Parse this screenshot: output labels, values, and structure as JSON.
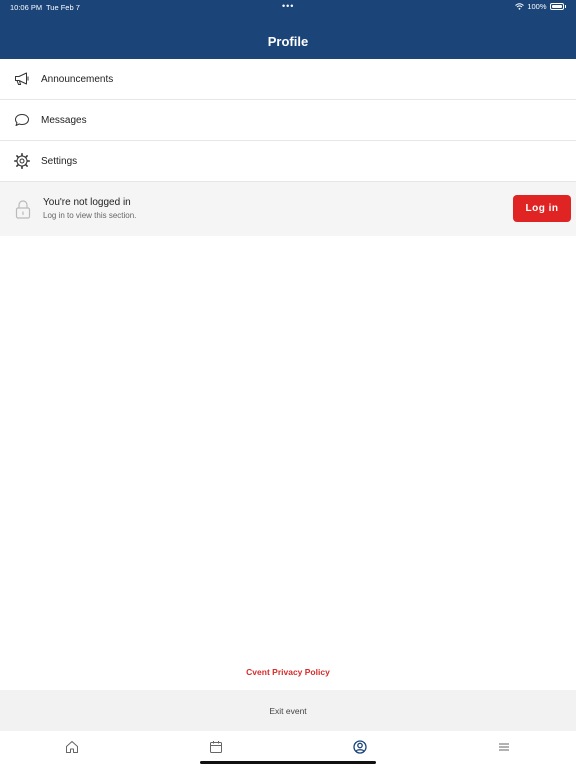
{
  "status_bar": {
    "time": "10:06 PM",
    "date": "Tue Feb 7",
    "dots": "•••",
    "battery_percent": "100%"
  },
  "header": {
    "title": "Profile"
  },
  "menu": {
    "items": [
      {
        "label": "Announcements",
        "icon": "megaphone-icon"
      },
      {
        "label": "Messages",
        "icon": "chat-bubble-icon"
      },
      {
        "label": "Settings",
        "icon": "gear-icon"
      }
    ]
  },
  "login": {
    "title": "You're not logged in",
    "subtitle": "Log in to view this section.",
    "button_label": "Log in",
    "icon": "lock-icon"
  },
  "footer": {
    "privacy_link": "Cvent Privacy Policy",
    "exit_label": "Exit event"
  },
  "tabbar": {
    "tabs": [
      {
        "icon": "home-icon",
        "active": false
      },
      {
        "icon": "calendar-icon",
        "active": false
      },
      {
        "icon": "profile-icon",
        "active": true
      },
      {
        "icon": "menu-icon",
        "active": false
      }
    ]
  },
  "colors": {
    "header": "#1b4479",
    "accent": "#e02424",
    "link": "#d62b2b"
  }
}
